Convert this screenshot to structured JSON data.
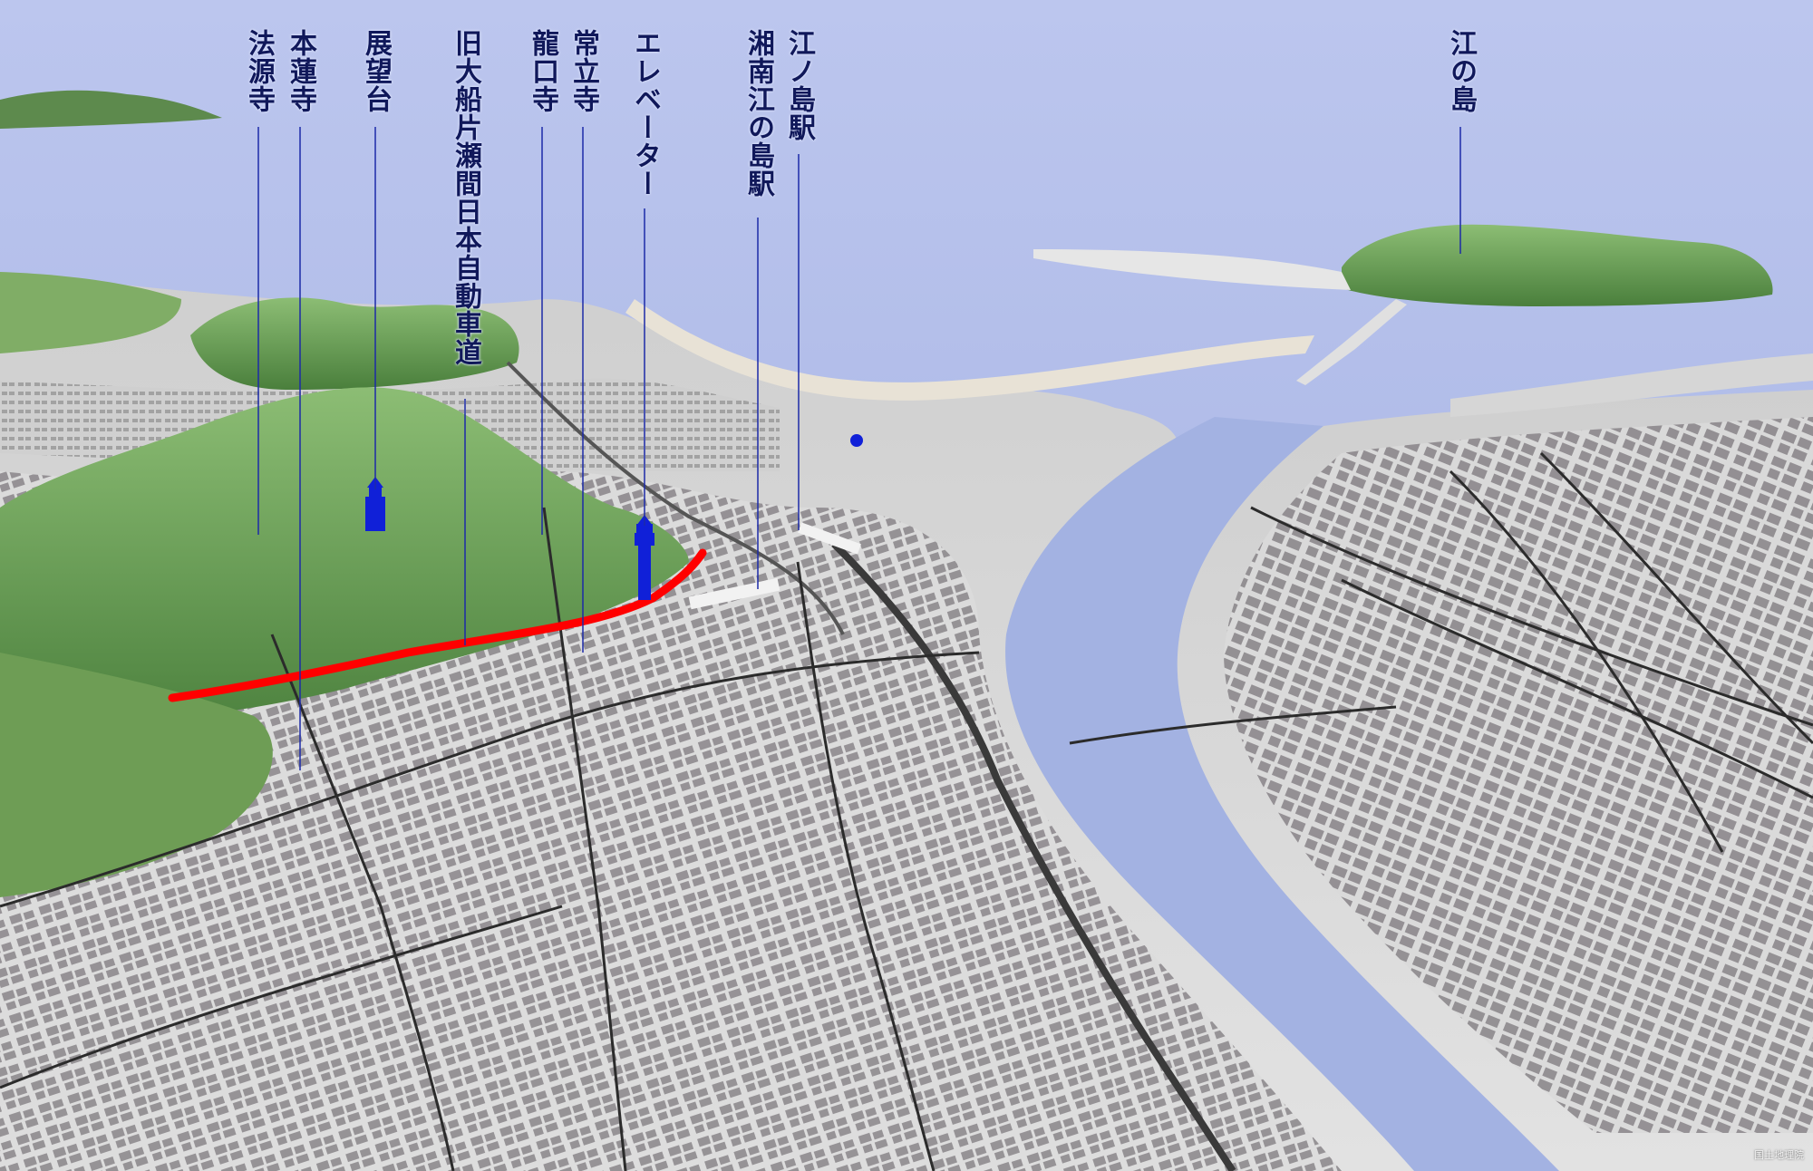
{
  "labels": [
    {
      "id": "hogenji",
      "text": "法源寺"
    },
    {
      "id": "honrenji",
      "text": "本蓮寺"
    },
    {
      "id": "tenbodai",
      "text": "展望台"
    },
    {
      "id": "expressway",
      "text": "旧大船片瀬間日本自動車道"
    },
    {
      "id": "ryukoji",
      "text": "龍口寺"
    },
    {
      "id": "joryuji",
      "text": "常立寺"
    },
    {
      "id": "elevator",
      "text": "エレベーター"
    },
    {
      "id": "shonan-enoshima-station",
      "text": "湘南江の島駅"
    },
    {
      "id": "enoshima-station",
      "text": "江ノ島駅"
    },
    {
      "id": "enoshima",
      "text": "江の島"
    }
  ],
  "credit": "国土地理院",
  "colors": {
    "sea": "#a9b6e3",
    "land": "#d8d8d8",
    "buildings": "#8e8a8e",
    "hills": "#6a9a55",
    "road_highlight": "#ff0000",
    "markers": "#1020d8",
    "leader_lines": "#1c2aa8"
  }
}
